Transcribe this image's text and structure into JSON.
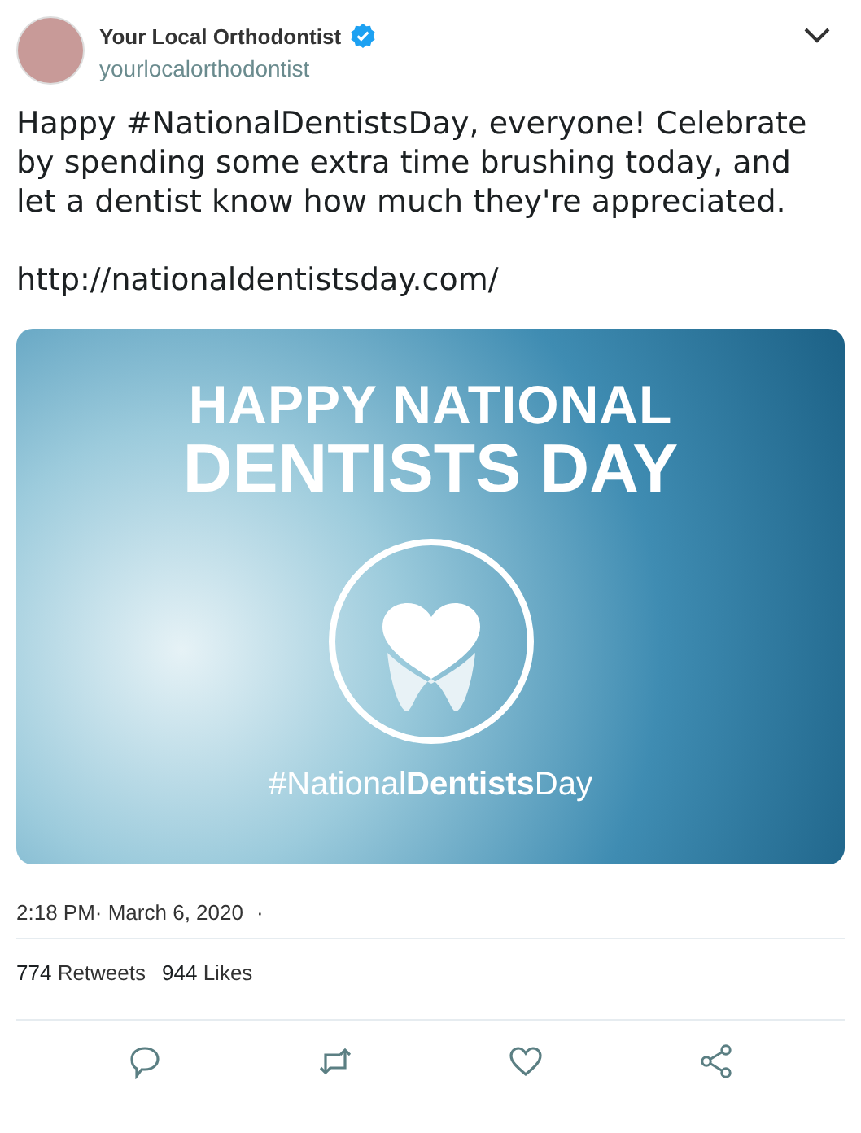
{
  "author": {
    "name": "Your Local Orthodontist",
    "verified": true,
    "handle": "yourlocalorthodontist"
  },
  "text": "Happy #NationalDentistsDay, everyone! Celebrate by spending some extra time brushing today, and let a dentist know how much they're appreciated.",
  "link": "http://nationaldentistsday.com/",
  "media": {
    "headline": [
      "HAPPY NATIONAL",
      "DENTISTS DAY"
    ],
    "hashtag": "#National**Dentists**Day"
  },
  "timestamp": "2:18 PM· March 6, 2020",
  "timestamp_separator": "·",
  "stats": [
    {
      "count": "774",
      "label": "Retweets"
    },
    {
      "count": "944",
      "label": "Likes"
    }
  ],
  "actions": [
    {
      "kind": "reply"
    },
    {
      "kind": "retweet"
    },
    {
      "kind": "like"
    },
    {
      "kind": "share"
    }
  ]
}
